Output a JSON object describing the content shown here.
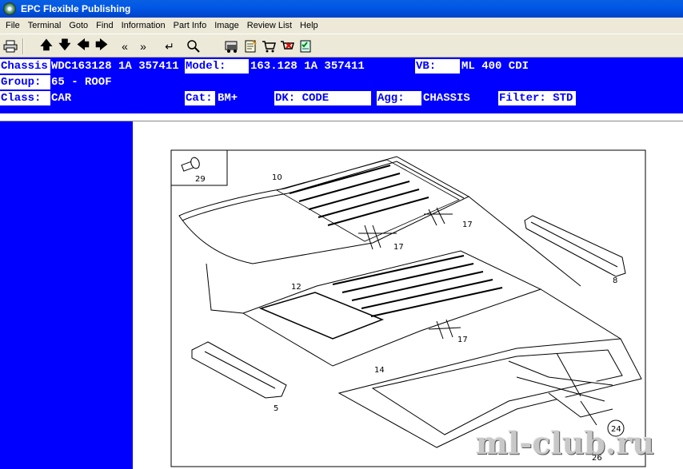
{
  "window": {
    "title": "EPC Flexible Publishing"
  },
  "menu": [
    "File",
    "Terminal",
    "Goto",
    "Find",
    "Information",
    "Part Info",
    "Image",
    "Review List",
    "Help"
  ],
  "toolbar": {
    "icons": [
      "print-icon",
      "arrow-up-icon",
      "arrow-down-icon",
      "arrow-left-icon",
      "arrow-right-icon",
      "double-left-icon",
      "double-right-icon",
      "enter-icon",
      "magnifier-icon",
      "vehicle-icon",
      "notepad-icon",
      "cart-icon",
      "cart-remove-icon",
      "checklist-icon"
    ]
  },
  "header": {
    "chassis_label": "Chassis:",
    "chassis_value": "WDC163128 1A 357411",
    "model_label": "Model:",
    "model_value": "163.128 1A 357411",
    "vb_label": "VB:",
    "vb_value": "ML 400 CDI",
    "group_label": "Group:",
    "group_value": "65 - ROOF",
    "class_label": "Class:",
    "class_value": "CAR",
    "cat_label": "Cat:",
    "cat_value": "BM+",
    "dk_label": "DK: CODE",
    "agg_label": "Agg:",
    "agg_value": "CHASSIS",
    "filter_label": "Filter: STD"
  },
  "diagram": {
    "callouts": [
      "29",
      "10",
      "17",
      "17",
      "8",
      "12",
      "17",
      "14",
      "5",
      "24",
      "26"
    ]
  },
  "watermark": "ml-club.ru"
}
